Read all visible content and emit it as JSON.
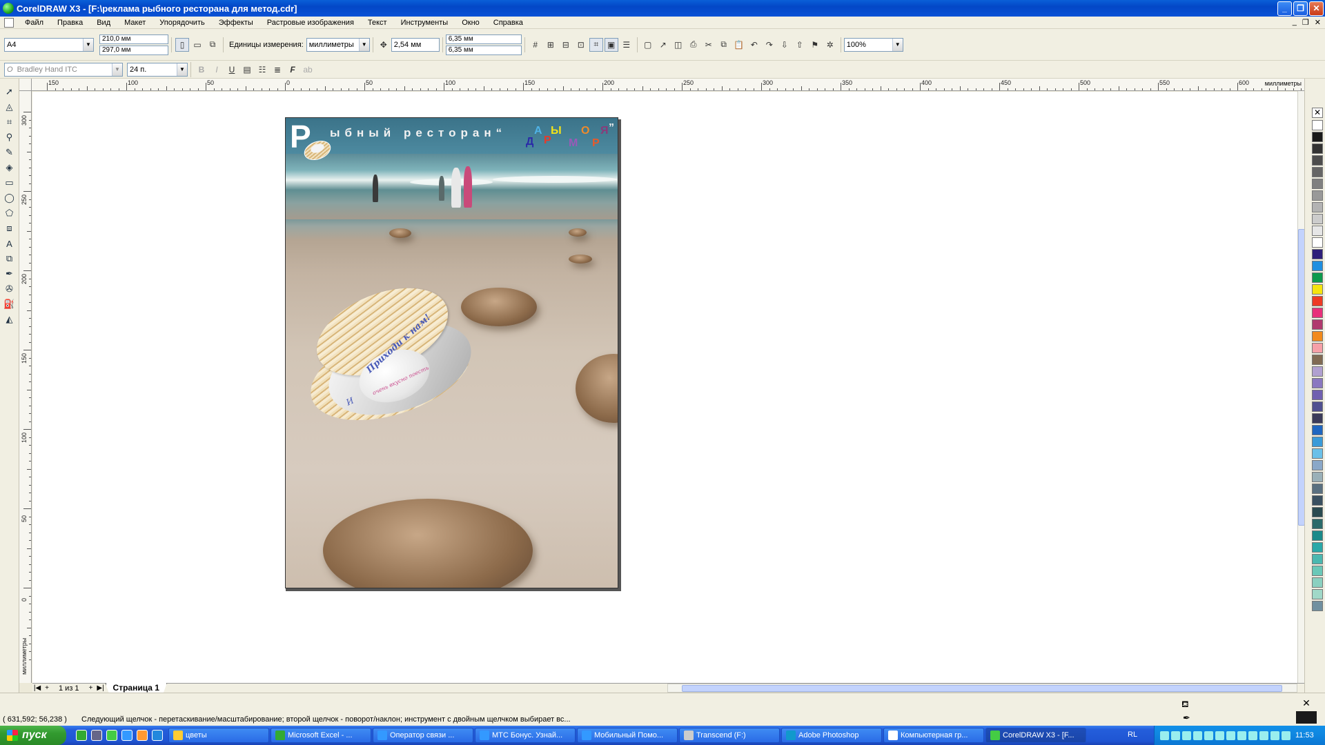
{
  "window": {
    "title": "CorelDRAW X3 - [F:\\реклама рыбного ресторана для метод.cdr]",
    "buttons": [
      "_",
      "❐",
      "✕"
    ]
  },
  "menu": {
    "items": [
      "Файл",
      "Правка",
      "Вид",
      "Макет",
      "Упорядочить",
      "Эффекты",
      "Растровые изображения",
      "Текст",
      "Инструменты",
      "Окно",
      "Справка"
    ],
    "right_controls": [
      "_",
      "❐",
      "✕"
    ]
  },
  "property_bar": {
    "paper_size": "A4",
    "width": "210,0 мм",
    "height": "297,0 мм",
    "units_label": "Единицы измерения:",
    "units_value": "миллиметры",
    "nudge": "2,54 мм",
    "dup_x": "6,35 мм",
    "dup_y": "6,35 мм",
    "zoom": "100%"
  },
  "text_bar": {
    "font": "Bradley Hand ITC",
    "size": "24 п."
  },
  "ruler": {
    "unit": "миллиметры",
    "h_labels": [
      "150",
      "100",
      "50",
      "0",
      "50",
      "100",
      "150",
      "200",
      "250",
      "300",
      "350",
      "400",
      "450",
      "500",
      "550",
      "600"
    ],
    "v_labels": [
      "300",
      "250",
      "200",
      "150",
      "100",
      "50",
      "0"
    ],
    "v_unit": "миллиметры"
  },
  "artwork": {
    "big_letter": "Р",
    "headline": "ыбный ресторан“",
    "brand_letters": [
      "А",
      "Ы",
      "О",
      "Я",
      "Д",
      "Р",
      "М",
      "Р"
    ],
    "quote_end": "”",
    "shell_text_1": "Приходи к нам!",
    "shell_text_2": "очень вкусно поесть",
    "shell_text_3": "И"
  },
  "pagebar": {
    "page_count": "1 из 1",
    "page_tab": "Страница 1"
  },
  "status": {
    "coords": "( 631,592; 56,238 )",
    "hint": "Следующий щелчок - перетаскивание/масштабирование; второй щелчок - поворот/наклон; инструмент с двойным щелчком выбирает вс..."
  },
  "taskbar": {
    "start_label": "пуск",
    "tasks": [
      "цветы",
      "Microsoft Excel - ...",
      "Оператор связи ...",
      "МТС Бонус. Узнай...",
      "Мобильный Помо...",
      "Transcend (F:)",
      "Adobe Photoshop",
      "Компьютерная гр...",
      "CorelDRAW X3 - [F..."
    ],
    "lang": "RL",
    "clock": "11:53"
  },
  "colors": {
    "palette": [
      "#ffffff",
      "#1a1a1a",
      "#333333",
      "#4d4d4d",
      "#666666",
      "#808080",
      "#999999",
      "#b3b3b3",
      "#cccccc",
      "#e6e6e6",
      "#ffffff",
      "#2e1f7a",
      "#1f8fe0",
      "#0d9a4c",
      "#f5e50f",
      "#ee3a24",
      "#e8307a",
      "#b03a6e",
      "#f28a1c",
      "#f6a0a8",
      "#806a53",
      "#b0a0d0",
      "#8a78c0",
      "#7060b0",
      "#505090",
      "#3b3b5a",
      "#1f66c0",
      "#3a9ad8",
      "#6ac0e8",
      "#8aa8c8",
      "#9ab0b8",
      "#5a7080",
      "#3a5060",
      "#2a4a50",
      "#2a6a6a",
      "#1a8a8a",
      "#2aa8a8",
      "#4ab8b0",
      "#6ac8b8",
      "#8ad0c0",
      "#a0d8c8",
      "#7090a0"
    ]
  }
}
